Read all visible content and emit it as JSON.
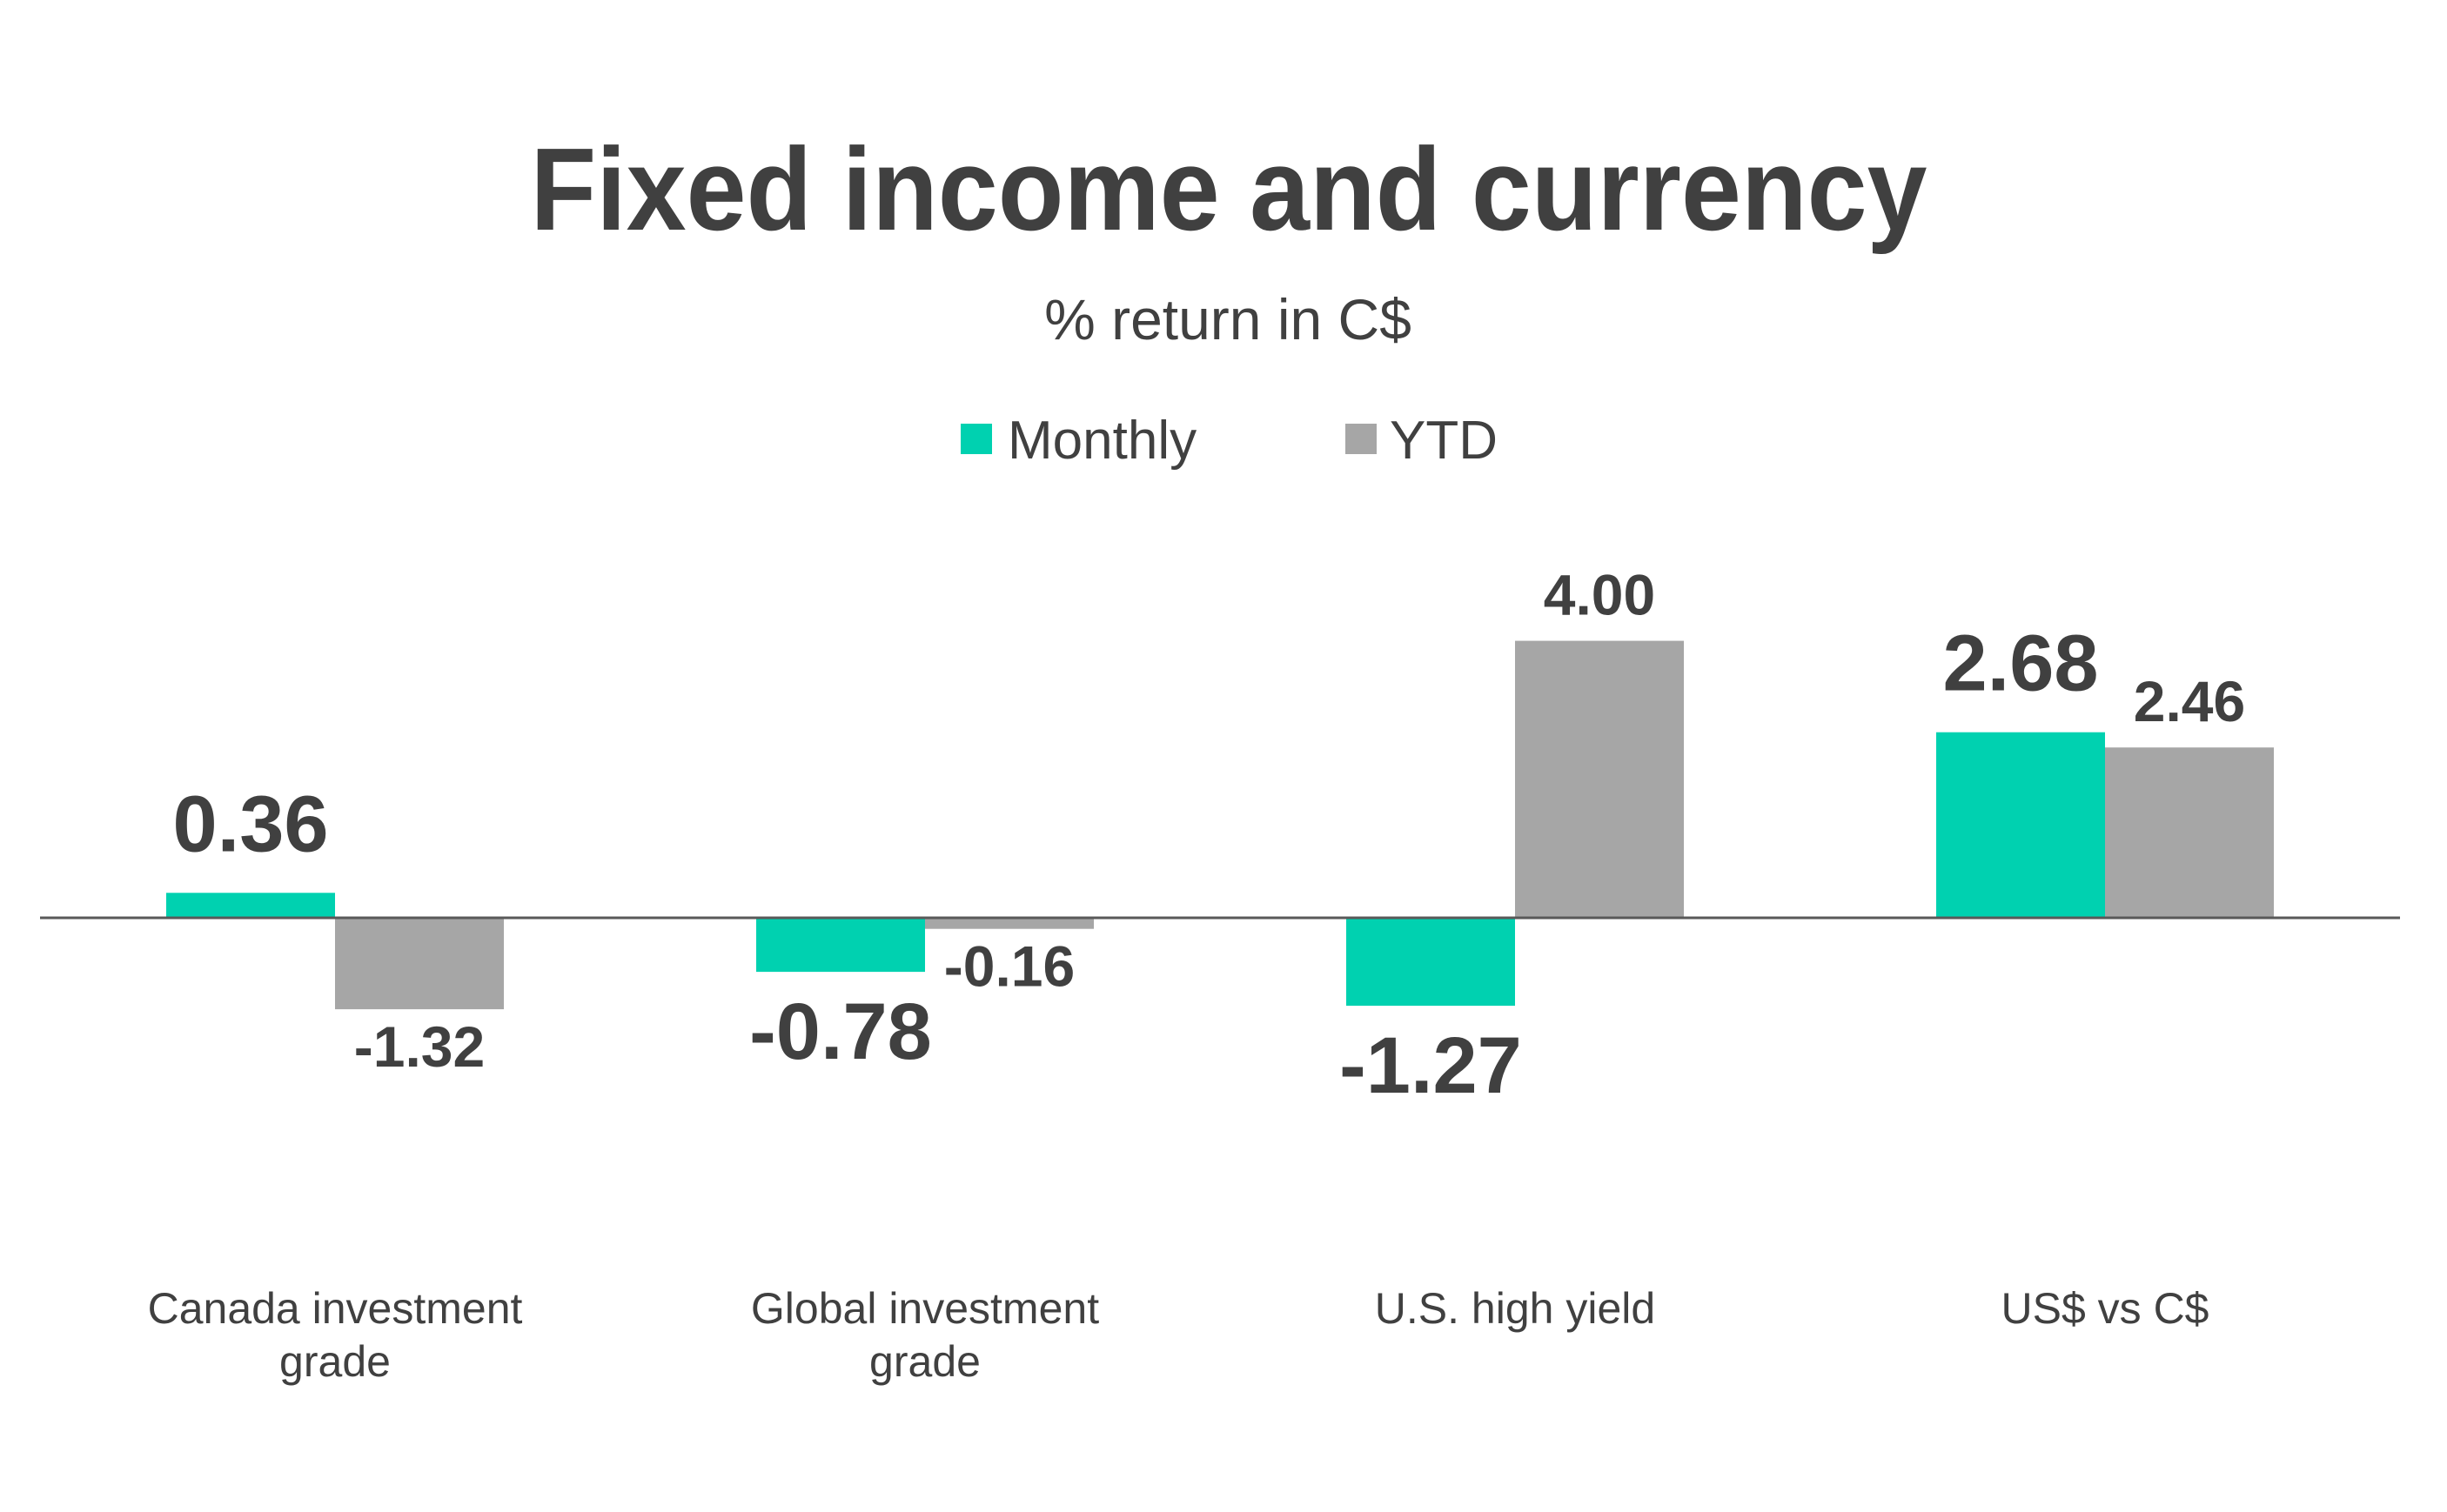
{
  "chart_data": {
    "type": "bar",
    "title": "Fixed income and currency",
    "subtitle": "% return in C$",
    "xlabel": "",
    "ylabel": "",
    "categories": [
      [
        "Canada investment",
        "grade"
      ],
      [
        "Global investment",
        "grade"
      ],
      [
        "U.S. high yield"
      ],
      [
        "US$ vs C$"
      ]
    ],
    "series": [
      {
        "name": "Monthly",
        "color": "#00D1B0",
        "values": [
          0.36,
          -0.78,
          -1.27,
          2.68
        ],
        "labels": [
          "0.36",
          "-0.78",
          "-1.27",
          "2.68"
        ],
        "label_emphasis": "large"
      },
      {
        "name": "YTD",
        "color": "#A6A6A6",
        "values": [
          -1.32,
          -0.16,
          4.0,
          2.46
        ],
        "labels": [
          "-1.32",
          "-0.16",
          "4.00",
          "2.46"
        ],
        "label_emphasis": "small"
      }
    ],
    "ylim": [
      -2.0,
      4.0
    ],
    "grid": false,
    "y_axis_visible": false,
    "zero_line": true,
    "legend": {
      "placement": "top-center",
      "entries": [
        "Monthly",
        "YTD"
      ]
    }
  },
  "colors": {
    "text": "#404040",
    "axis": "#595959",
    "monthly": "#00D1B0",
    "ytd": "#A6A6A6"
  }
}
